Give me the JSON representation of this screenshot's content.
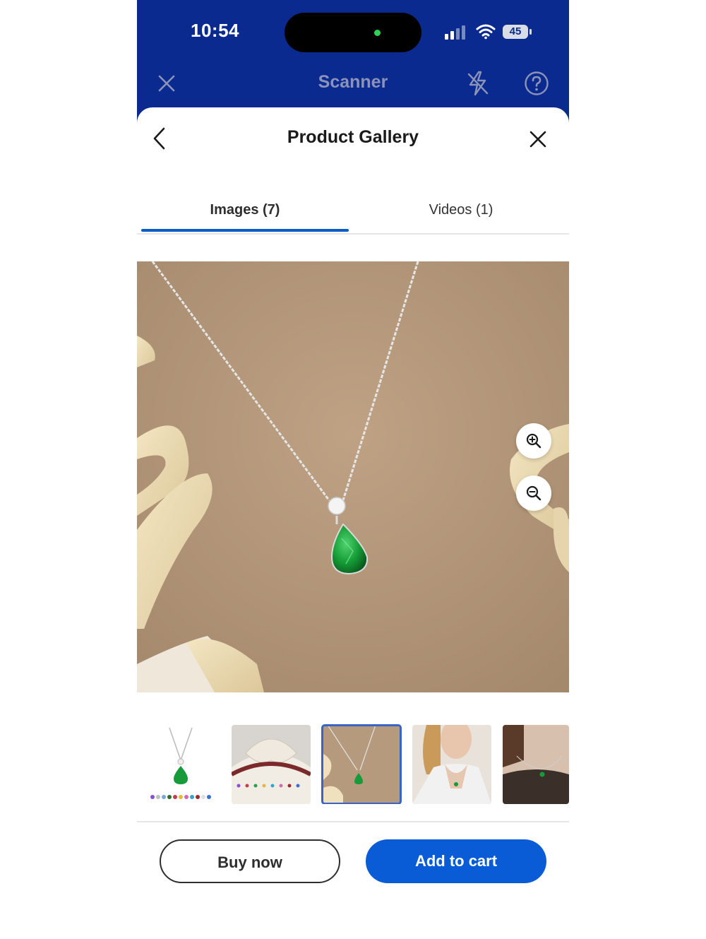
{
  "status_bar": {
    "time": "10:54",
    "battery": "45"
  },
  "scanner_header": {
    "title": "Scanner"
  },
  "sheet": {
    "title": "Product Gallery"
  },
  "tabs": [
    {
      "label": "Images (7)",
      "selected": true
    },
    {
      "label": "Videos (1)",
      "selected": false
    }
  ],
  "main_image": {
    "subject": "silver chain necklace with green pear-shaped pendant on beige background"
  },
  "thumbnails": [
    {
      "subject": "necklace with birthstone color options",
      "selected": false
    },
    {
      "subject": "necklaces in gift box",
      "selected": false
    },
    {
      "subject": "necklace on beige background",
      "selected": true
    },
    {
      "subject": "model wearing necklace with white shirt",
      "selected": false
    },
    {
      "subject": "model wearing necklace with brown top",
      "selected": false
    }
  ],
  "actions": {
    "buy_now": "Buy now",
    "add_to_cart": "Add to cart"
  },
  "colors": {
    "header_bg": "#0a2a8f",
    "accent": "#0a5cd6",
    "tab_indicator": "#0a5cc7",
    "thumb_selected": "#3b63c4"
  },
  "icons": [
    "close-icon",
    "flash-off-icon",
    "help-icon",
    "back-chevron-icon",
    "zoom-in-icon",
    "zoom-out-icon"
  ]
}
